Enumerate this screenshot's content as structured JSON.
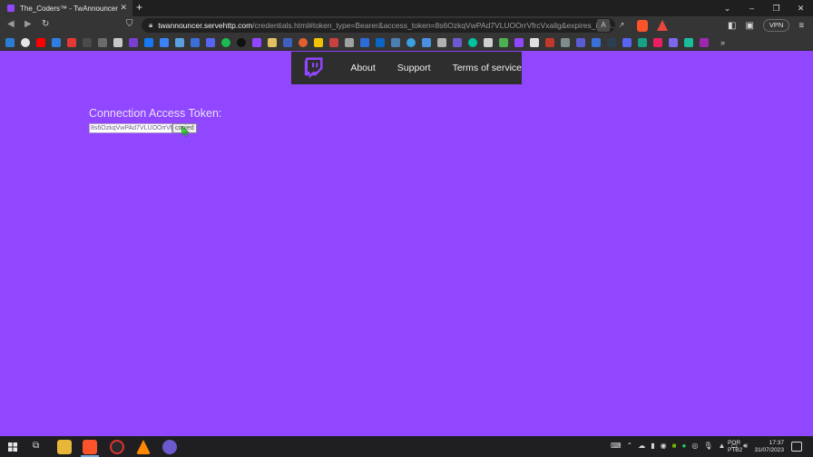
{
  "browser": {
    "tab_title": "The_Coders™ - TwAnnouncer",
    "tab_close": "✕",
    "new_tab": "+",
    "url_host": "twannouncer.servehttp.com",
    "url_rest": "/credentials.html#token_type=Bearer&access_token=8s6OzkqVwPAd7VLUOOrrVfrcVxallg&expires_in=6...",
    "vpn_label": "VPN",
    "window_controls": [
      "⌄",
      "–",
      "❐",
      "✕"
    ]
  },
  "site_nav": {
    "links": [
      "About",
      "Support",
      "Terms of service"
    ]
  },
  "token": {
    "heading": "Connection Access Token:",
    "value": "8s6OzkqVwPAd7VLUOOrrVfrcVxallg",
    "copy_label": "copied"
  },
  "taskbar": {
    "lang_line1": "POR",
    "lang_line2": "PTB2",
    "time": "17:37",
    "date": "31/07/2023"
  },
  "colors": {
    "page_bg": "#9146ff",
    "nav_bg": "#2e2e2e",
    "chrome_bg": "#353535"
  }
}
